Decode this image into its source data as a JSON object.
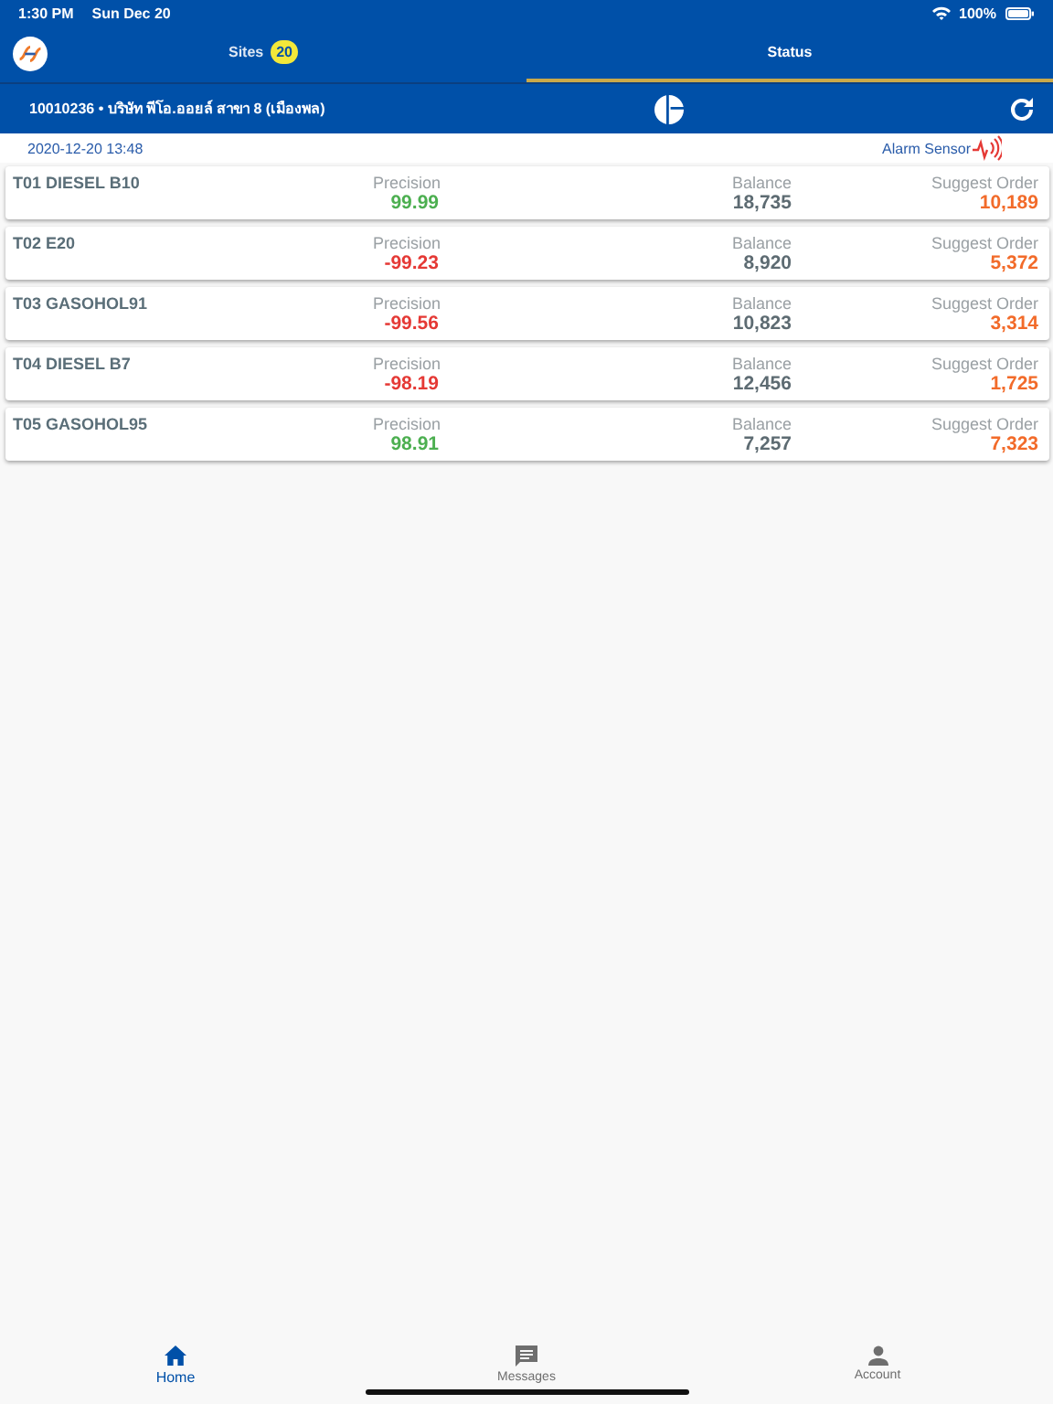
{
  "status_bar": {
    "time": "1:30 PM",
    "date": "Sun Dec 20",
    "battery": "100%"
  },
  "tabs": [
    {
      "label": "Sites",
      "badge": "20",
      "selected": false
    },
    {
      "label": "Status",
      "selected": true
    }
  ],
  "site": {
    "title": "10010236 • บริษัท พีโอ.ออยล์ สาขา 8 (เมืองพล)"
  },
  "timestamp": "2020-12-20 13:48",
  "alarm": {
    "label": "Alarm Sensor"
  },
  "tanks": [
    {
      "name": "T01 DIESEL B10",
      "precision": {
        "label": "Precision",
        "value": "99.99",
        "color": "#4caf50"
      },
      "balance": {
        "label": "Balance",
        "value": "18,735"
      },
      "order": {
        "label": "Suggest Order",
        "value": "10,189"
      }
    },
    {
      "name": "T02 E20",
      "precision": {
        "label": "Precision",
        "value": "-99.23",
        "color": "#e53935"
      },
      "balance": {
        "label": "Balance",
        "value": "8,920"
      },
      "order": {
        "label": "Suggest Order",
        "value": "5,372"
      }
    },
    {
      "name": "T03 GASOHOL91",
      "precision": {
        "label": "Precision",
        "value": "-99.56",
        "color": "#e53935"
      },
      "balance": {
        "label": "Balance",
        "value": "10,823"
      },
      "order": {
        "label": "Suggest Order",
        "value": "3,314"
      }
    },
    {
      "name": "T04 DIESEL B7",
      "precision": {
        "label": "Precision",
        "value": "-98.19",
        "color": "#e53935"
      },
      "balance": {
        "label": "Balance",
        "value": "12,456"
      },
      "order": {
        "label": "Suggest Order",
        "value": "1,725"
      }
    },
    {
      "name": "T05 GASOHOL95",
      "precision": {
        "label": "Precision",
        "value": "98.91",
        "color": "#4caf50"
      },
      "balance": {
        "label": "Balance",
        "value": "7,257"
      },
      "order": {
        "label": "Suggest Order",
        "value": "7,323"
      }
    }
  ],
  "nav": [
    {
      "label": "Home",
      "kind": "home",
      "selected": true
    },
    {
      "label": "Messages",
      "kind": "messages",
      "selected": false
    },
    {
      "label": "Account",
      "kind": "account",
      "selected": false
    }
  ]
}
